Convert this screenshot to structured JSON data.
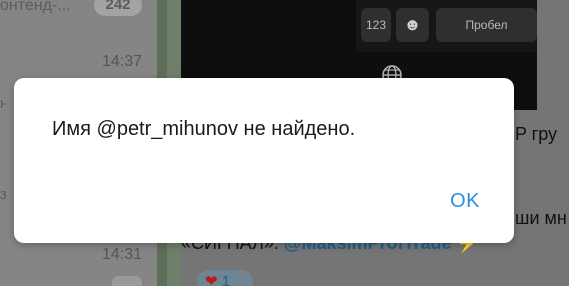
{
  "chat_list": {
    "snippet": "онтенд-...",
    "badge": "242",
    "edge_char_1": "н",
    "edge_char_2": "з",
    "timestamps": [
      "14:37",
      "14:31"
    ]
  },
  "keyboard": {
    "key_123": "123",
    "key_emoji": "☻",
    "key_space": "Пробел"
  },
  "chat": {
    "edge_text_1": "IP гру",
    "edge_text_2": "ши мн",
    "message_prefix": "«СИГНАЛ»: ",
    "mention": "@MaksimProfTrade",
    "bolt": "⚡",
    "reaction": {
      "emoji": "❤",
      "count": "1"
    }
  },
  "dialog": {
    "message": "Имя @petr_mihunov не найдено.",
    "ok_label": "OK"
  },
  "colors": {
    "dialog_bg": "#ffffff",
    "ok_text": "#2f8fd9",
    "overlay": "#7d7d7d"
  }
}
